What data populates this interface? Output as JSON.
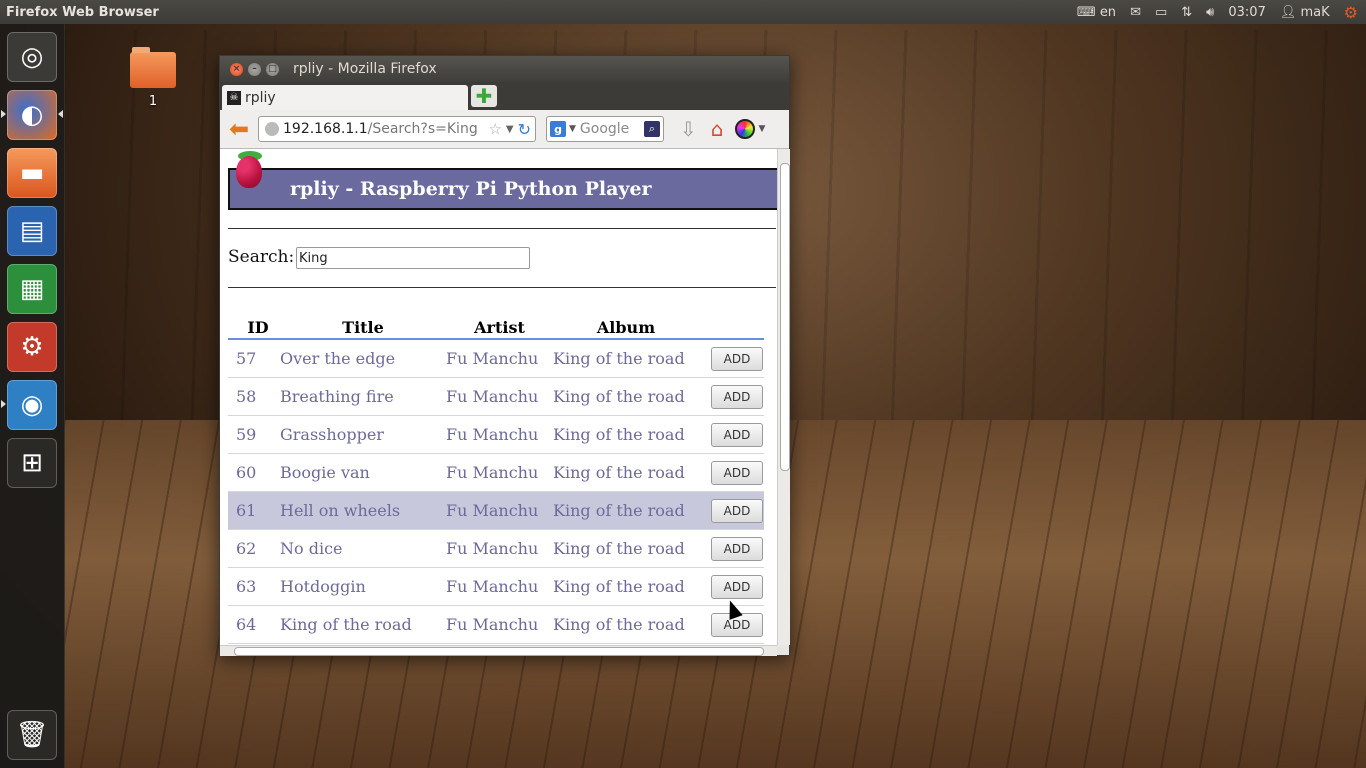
{
  "top_panel": {
    "app_title": "Firefox Web Browser",
    "keyboard_lang": "en",
    "clock": "03:07",
    "user": "maK"
  },
  "desktop": {
    "folder_label": "1"
  },
  "window": {
    "title": "rpliy - Mozilla Firefox",
    "tab_label": "rpliy",
    "url_host": "192.168.1.1",
    "url_path": "/Search?s=King",
    "search_engine_placeholder": "Google"
  },
  "page": {
    "header_title": "rpliy - Raspberry Pi Python Player",
    "search_label": "Search:",
    "search_value": "King",
    "columns": [
      "ID",
      "Title",
      "Artist",
      "Album"
    ],
    "rows": [
      {
        "id": "57",
        "title": "Over the edge",
        "artist": "Fu Manchu",
        "album": "King of the road",
        "action": "ADD"
      },
      {
        "id": "58",
        "title": "Breathing fire",
        "artist": "Fu Manchu",
        "album": "King of the road",
        "action": "ADD"
      },
      {
        "id": "59",
        "title": "Grasshopper",
        "artist": "Fu Manchu",
        "album": "King of the road",
        "action": "ADD"
      },
      {
        "id": "60",
        "title": "Boogie van",
        "artist": "Fu Manchu",
        "album": "King of the road",
        "action": "ADD"
      },
      {
        "id": "61",
        "title": "Hell on wheels",
        "artist": "Fu Manchu",
        "album": "King of the road",
        "action": "ADD"
      },
      {
        "id": "62",
        "title": "No dice",
        "artist": "Fu Manchu",
        "album": "King of the road",
        "action": "ADD"
      },
      {
        "id": "63",
        "title": "Hotdoggin",
        "artist": "Fu Manchu",
        "album": "King of the road",
        "action": "ADD"
      },
      {
        "id": "64",
        "title": "King of the road",
        "artist": "Fu Manchu",
        "album": "King of the road",
        "action": "ADD"
      }
    ],
    "highlighted_row_id": "61"
  },
  "launcher": {
    "items": [
      "ubuntu-home-icon",
      "firefox-icon",
      "files-icon",
      "writer-icon",
      "calc-icon",
      "settings-icon",
      "chromium-icon",
      "workspace-switcher-icon",
      "trash-icon"
    ]
  },
  "colors": {
    "header_bg": "#6b6a9e",
    "link_text": "#6c6a9a",
    "highlight_row": "#c8c8dc",
    "panel_bg": "#3c3b37"
  }
}
